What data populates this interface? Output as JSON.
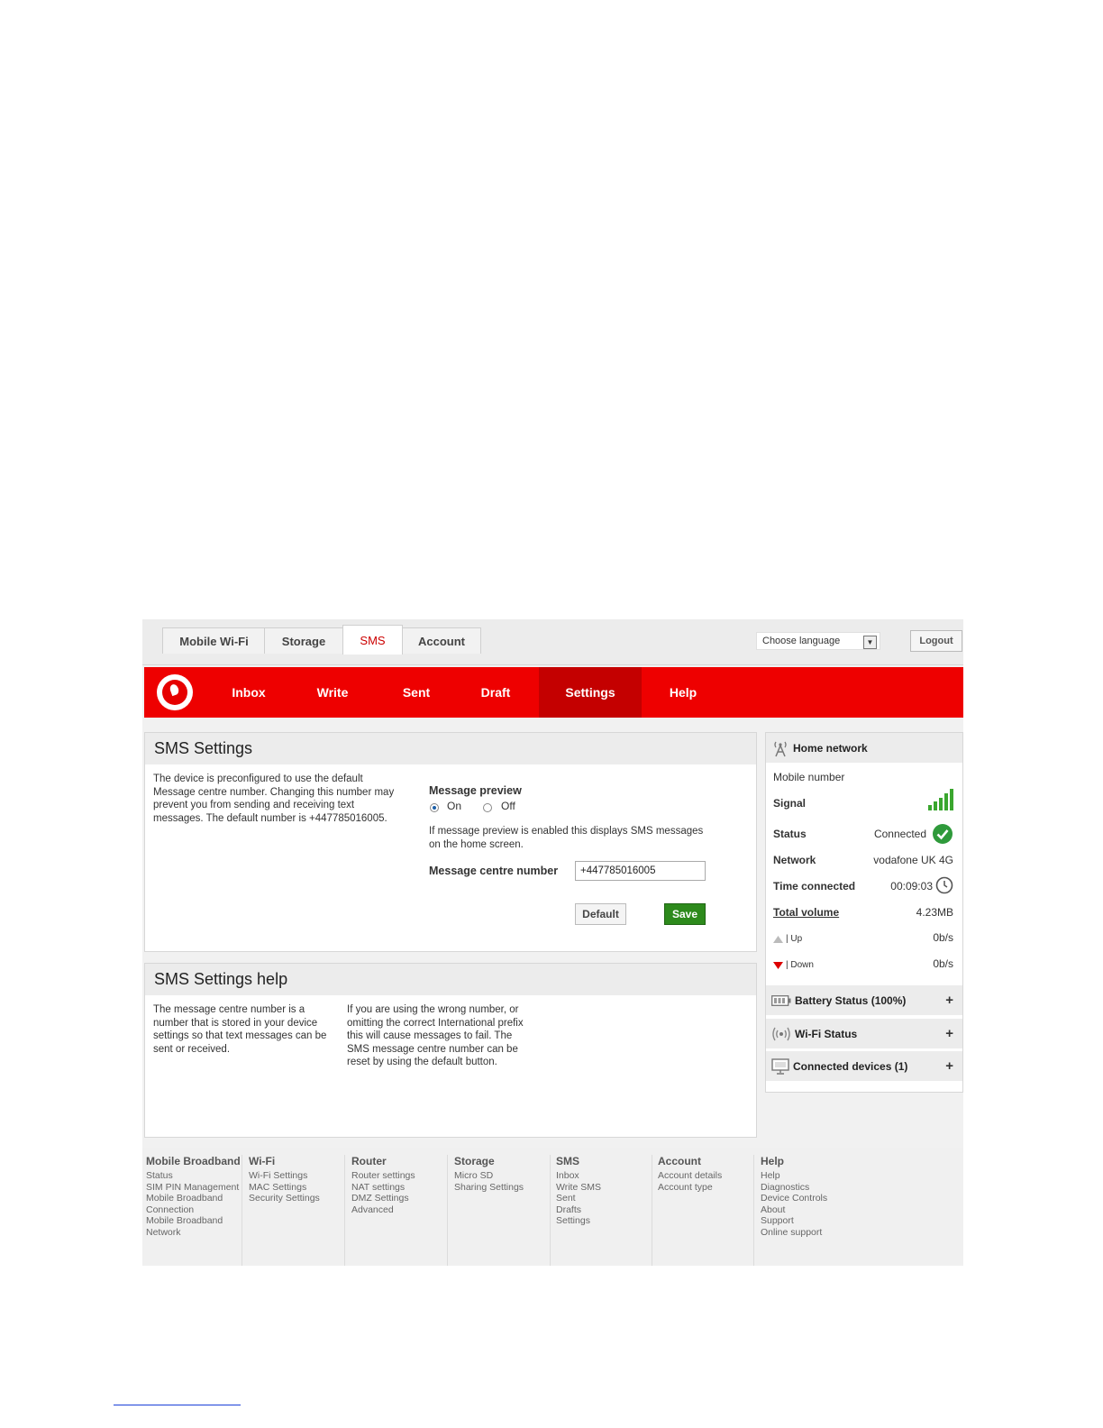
{
  "top_tabs": [
    {
      "label": "Mobile Wi-Fi",
      "active": false
    },
    {
      "label": "Storage",
      "active": false
    },
    {
      "label": "SMS",
      "active": true
    },
    {
      "label": "Account",
      "active": false
    }
  ],
  "language_select": {
    "value": "Choose language"
  },
  "logout_label": "Logout",
  "nav": [
    {
      "label": "Inbox"
    },
    {
      "label": "Write"
    },
    {
      "label": "Sent"
    },
    {
      "label": "Draft"
    },
    {
      "label": "Settings",
      "active": true
    },
    {
      "label": "Help"
    }
  ],
  "settings_panel": {
    "title": "SMS Settings",
    "description": [
      "The device is preconfigured to use the default",
      "Message centre number. Changing this number may",
      "prevent you from sending and receiving text",
      "messages. The default number is +447785016005."
    ],
    "preview_label": "Message preview",
    "preview_on": "On",
    "preview_off": "Off",
    "preview_note": [
      "If message preview is enabled this displays SMS messages",
      "on the home screen."
    ],
    "centre_number_label": "Message centre number",
    "centre_number_value": "+447785016005",
    "default_button": "Default",
    "save_button": "Save"
  },
  "help_panel": {
    "title": "SMS Settings help",
    "col1": [
      "The message centre number is a",
      "number that is stored in your device",
      "settings so that text messages can be",
      "sent or received."
    ],
    "col2": [
      "If you are using the wrong number, or",
      "omitting the correct International prefix",
      "this will cause messages to fail. The",
      "SMS message centre number can be",
      "reset by using the default button."
    ]
  },
  "sidebar": {
    "home_network": "Home network",
    "mobile_number_label": "Mobile number",
    "signal_label": "Signal",
    "signal_level": 5,
    "status_label": "Status",
    "status_value": "Connected",
    "network_label": "Network",
    "network_value": "vodafone UK 4G",
    "time_label": "Time connected",
    "time_value": "00:09:03",
    "volume_label": "Total volume",
    "volume_value": "4.23MB",
    "up_label": "| Up",
    "up_value": "0b/s",
    "down_label": "| Down",
    "down_value": "0b/s",
    "battery": "Battery Status (100%)",
    "wifi": "Wi-Fi Status",
    "devices": "Connected devices (1)",
    "plus": "+"
  },
  "footer": [
    {
      "heading": "Mobile Broadband",
      "links": [
        "Status",
        "SIM PIN Management",
        "Mobile Broadband",
        "Connection",
        "Mobile Broadband",
        "Network"
      ]
    },
    {
      "heading": "Wi-Fi",
      "links": [
        "Wi-Fi Settings",
        "MAC Settings",
        "Security Settings"
      ]
    },
    {
      "heading": "Router",
      "links": [
        "Router settings",
        "NAT settings",
        "DMZ Settings",
        "Advanced"
      ]
    },
    {
      "heading": "Storage",
      "links": [
        "Micro SD",
        "Sharing Settings"
      ]
    },
    {
      "heading": "SMS",
      "links": [
        "Inbox",
        "Write SMS",
        "Sent",
        "Drafts",
        "Settings"
      ]
    },
    {
      "heading": "Account",
      "links": [
        "Account details",
        "Account type"
      ]
    },
    {
      "heading": "Help",
      "links": [
        "Help",
        "Diagnostics",
        "Device Controls",
        "About",
        "Support",
        "Online support"
      ]
    }
  ]
}
